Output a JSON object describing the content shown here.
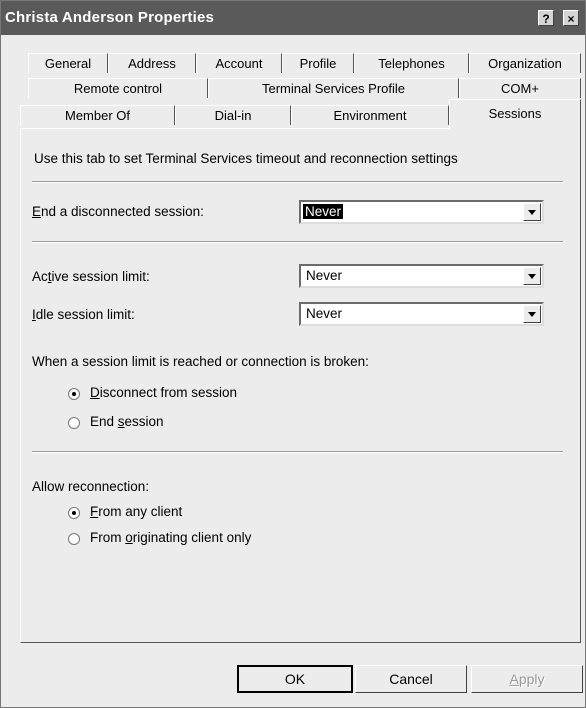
{
  "window": {
    "title": "Christa Anderson Properties",
    "help_label": "?",
    "close_label": "×"
  },
  "tabs": {
    "row1": [
      "General",
      "Address",
      "Account",
      "Profile",
      "Telephones",
      "Organization"
    ],
    "row2": [
      "Remote control",
      "Terminal Services Profile",
      "COM+"
    ],
    "row3": [
      "Member Of",
      "Dial-in",
      "Environment",
      "Sessions"
    ],
    "active": "Sessions"
  },
  "sessions": {
    "intro": "Use this tab to set Terminal Services timeout and reconnection settings",
    "end_disconnected_label_pre": "",
    "end_disconnected_label_key": "E",
    "end_disconnected_label_post": "nd a disconnected session:",
    "end_disconnected_value": "Never",
    "active_limit_label_pre": "Ac",
    "active_limit_label_key": "t",
    "active_limit_label_post": "ive session limit:",
    "active_limit_value": "Never",
    "idle_limit_label_pre": "",
    "idle_limit_label_key": "I",
    "idle_limit_label_post": "dle session limit:",
    "idle_limit_value": "Never",
    "limit_reached_label": "When a session limit is reached or connection is broken:",
    "limit_options": [
      {
        "pre": "",
        "key": "D",
        "post": "isconnect from session",
        "checked": true
      },
      {
        "pre": "End ",
        "key": "s",
        "post": "ession",
        "checked": false
      }
    ],
    "reconnection_label": "Allow reconnection:",
    "reconnection_options": [
      {
        "pre": "",
        "key": "F",
        "post": "rom any client",
        "checked": true
      },
      {
        "pre": "From ",
        "key": "o",
        "post": "riginating client only",
        "checked": false
      }
    ]
  },
  "buttons": {
    "ok": "OK",
    "cancel": "Cancel",
    "apply_key": "A",
    "apply_post": "pply"
  }
}
